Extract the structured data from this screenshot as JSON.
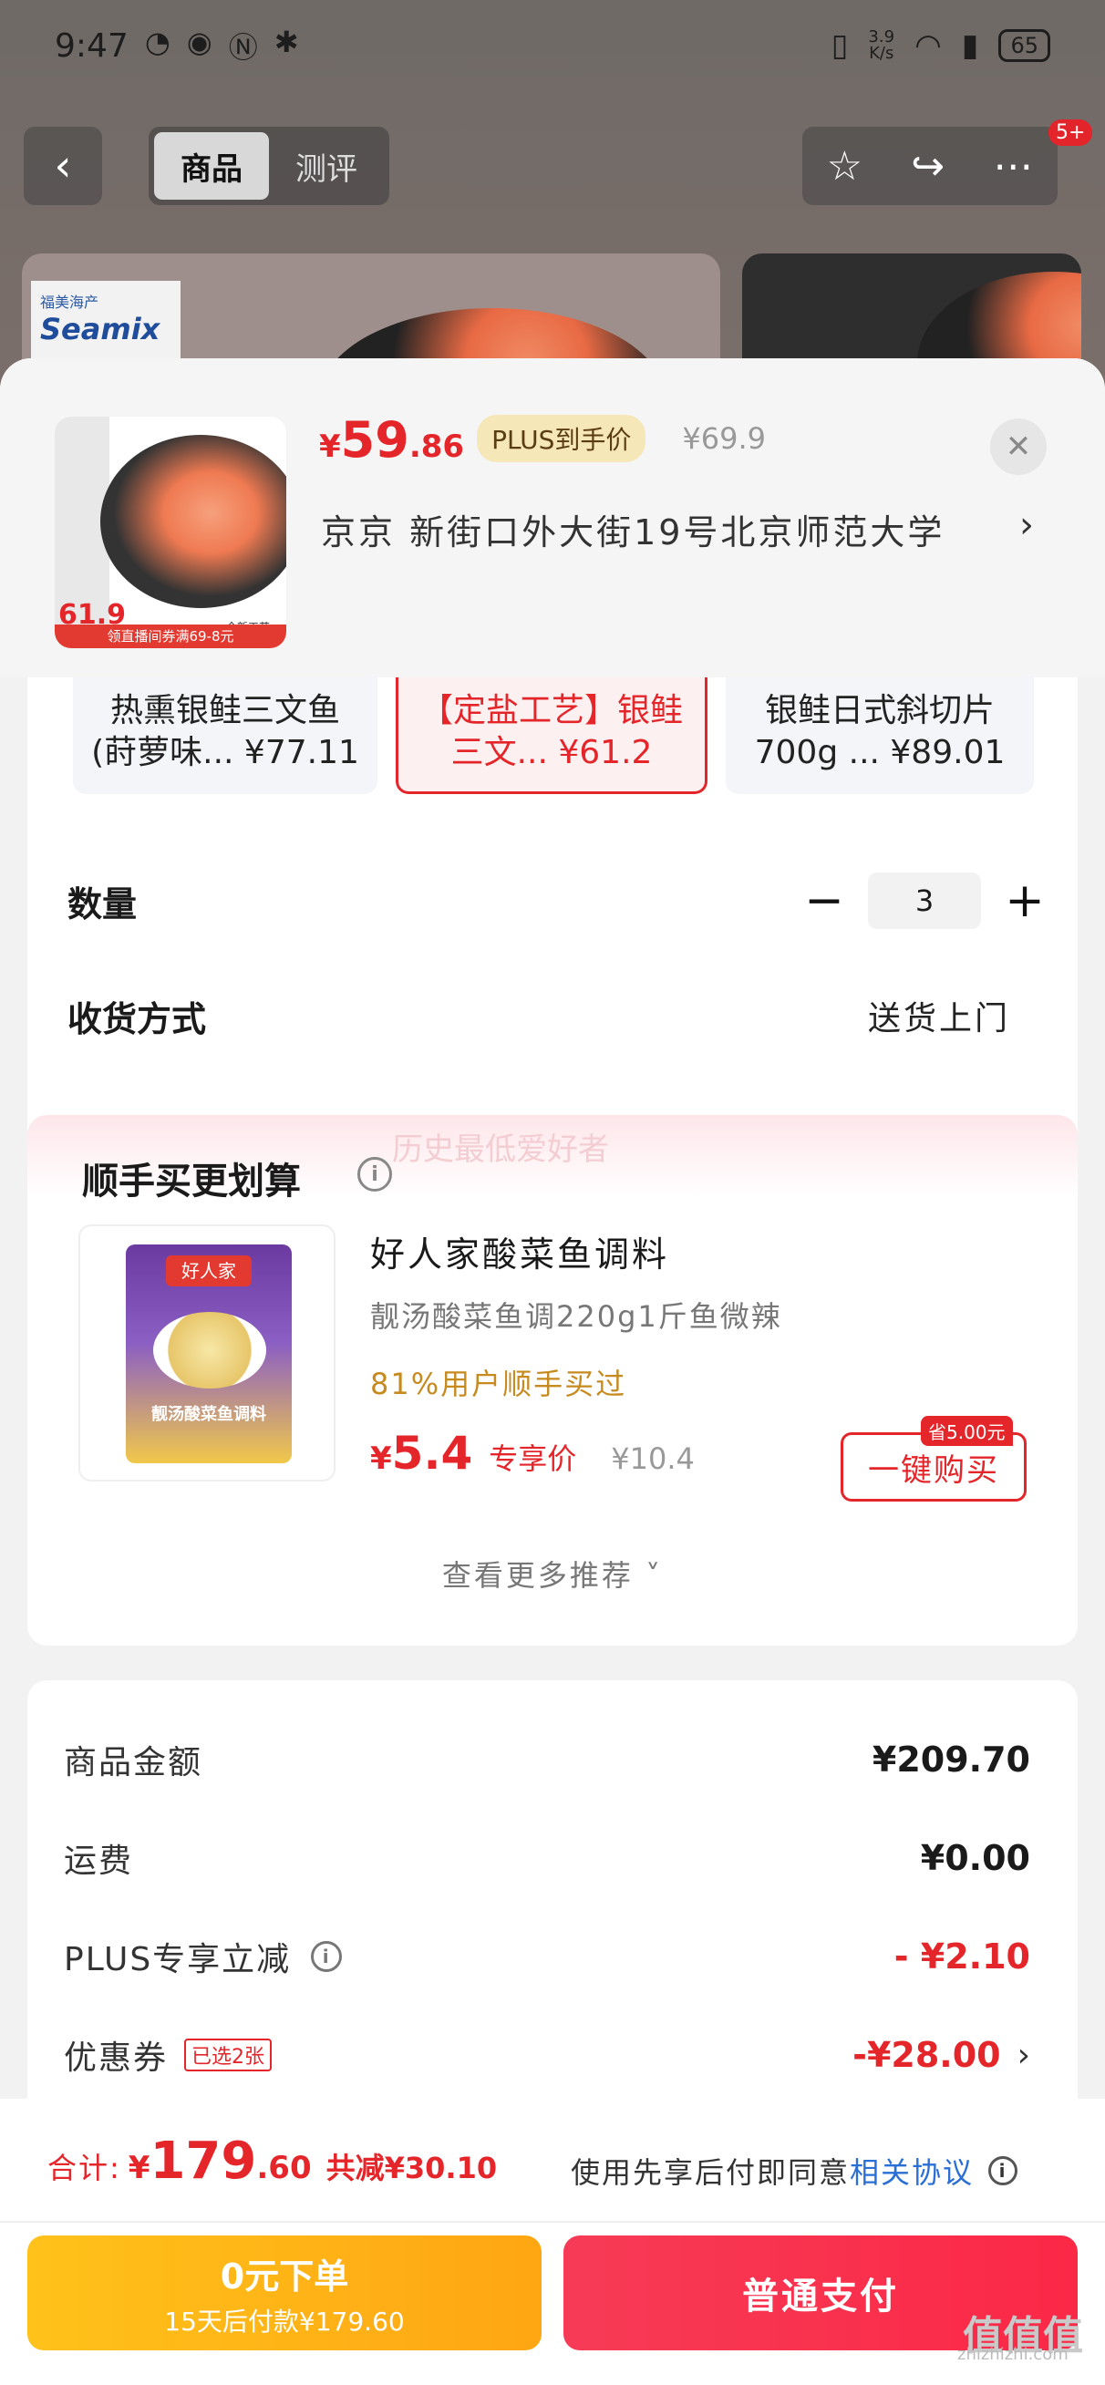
{
  "status_bar": {
    "time": "9:47",
    "speed": "3.9\nK/s",
    "battery": "65"
  },
  "nav": {
    "tabs": [
      "商品",
      "测评"
    ],
    "badge": "5+"
  },
  "background": {
    "brand_cn": "福美海产",
    "brand_en": "Seamix"
  },
  "sheet": {
    "thumb_price": "61.9",
    "thumb_banner": "领直播间券满69-8元",
    "thumb_mini": "全新工艺",
    "price": {
      "symbol": "¥",
      "int": "59",
      "dec": ".86"
    },
    "plus_badge": "PLUS到手价",
    "original_price": "¥69.9",
    "address": "京京   新街口外大街19号北京师范大学",
    "variants": [
      {
        "line1": "热熏银鲑三文鱼",
        "line2": "(莳萝味... ¥77.11"
      },
      {
        "line1": "【定盐工艺】银鲑",
        "line2": "三文... ¥61.2"
      },
      {
        "line1": "银鲑日式斜切片",
        "line2": "700g ... ¥89.01"
      }
    ],
    "quantity_label": "数量",
    "quantity_value": "3",
    "delivery_label": "收货方式",
    "delivery_value": "送货上门"
  },
  "recommend": {
    "watermark": "历史最低爱好者",
    "title": "顺手买更划算",
    "pack_logo": "好人家",
    "pack_name": "靓汤酸菜鱼调料",
    "name": "好人家酸菜鱼调料",
    "subtitle": "靓汤酸菜鱼调220g1斤鱼微辣",
    "bought": "81%用户顺手买过",
    "price_symbol": "¥",
    "price_int": "5.4",
    "price_label": "专享价",
    "original_price": "¥10.4",
    "save_tag": "省5.00元",
    "buy_label": "一键购买",
    "more_label": "查看更多推荐 ˅"
  },
  "summary": {
    "rows": [
      {
        "label": "商品金额",
        "value": "¥209.70"
      },
      {
        "label": "运费",
        "value": "¥0.00"
      },
      {
        "label": "PLUS专享立减",
        "value": "- ¥2.10"
      },
      {
        "label": "优惠券",
        "tag": "已选2张",
        "value": "-¥28.00"
      }
    ]
  },
  "bottom": {
    "total_label": "合计:",
    "total_symbol": "¥",
    "total_int": "179",
    "total_dec": ".60",
    "saved": "共减¥30.10",
    "agree_text": "使用先享后付即同意",
    "agree_link": "相关协议",
    "credit_title": "0元下单",
    "credit_sub": "15天后付款¥179.60",
    "pay_label": "普通支付",
    "watermark": "zhizhizhi.com",
    "watermark_big": "值值值"
  },
  "colors": {
    "accent_red": "#e4262b",
    "gold": "#ffb516",
    "link_blue": "#2a6fd6"
  }
}
